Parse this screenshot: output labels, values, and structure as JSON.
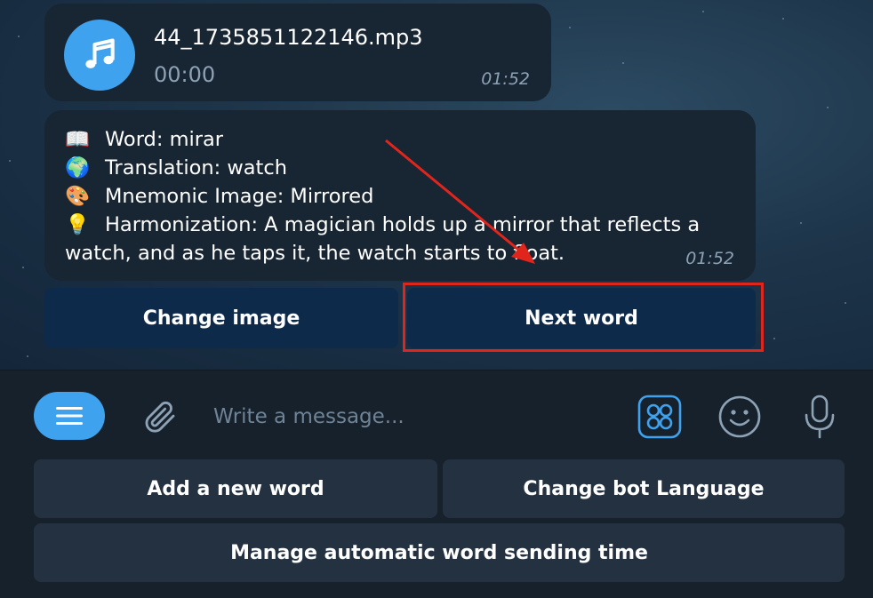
{
  "audio_message": {
    "filename": "44_1735851122146.mp3",
    "duration": "00:00",
    "time": "01:52",
    "icon": "music-note-icon"
  },
  "word_message": {
    "lines": [
      {
        "emoji": "📖",
        "text": "Word: mirar"
      },
      {
        "emoji": "🌍",
        "text": "Translation: watch"
      },
      {
        "emoji": "🎨",
        "text": "Mnemonic Image: Mirrored"
      },
      {
        "emoji": "💡",
        "text": "Harmonization: A magician holds up a mirror that reflects a watch, and as he taps it, the watch starts to float."
      }
    ],
    "time": "01:52"
  },
  "inline_buttons": {
    "change_image": "Change image",
    "next_word": "Next word"
  },
  "annotation": {
    "highlight_color": "#e0261c"
  },
  "composer": {
    "placeholder": "Write a message...",
    "icons": [
      "menu-icon",
      "paperclip-icon",
      "apps-grid-icon",
      "emoji-icon",
      "microphone-icon"
    ]
  },
  "keyboard": {
    "add_word": "Add a new word",
    "change_language": "Change bot Language",
    "manage_time": "Manage automatic word sending time"
  },
  "colors": {
    "accent": "#3fa2ee",
    "bubble": "#182533",
    "inline_button": "#0e2a4a",
    "keyboard_button": "#243140",
    "panel": "#17212b"
  }
}
